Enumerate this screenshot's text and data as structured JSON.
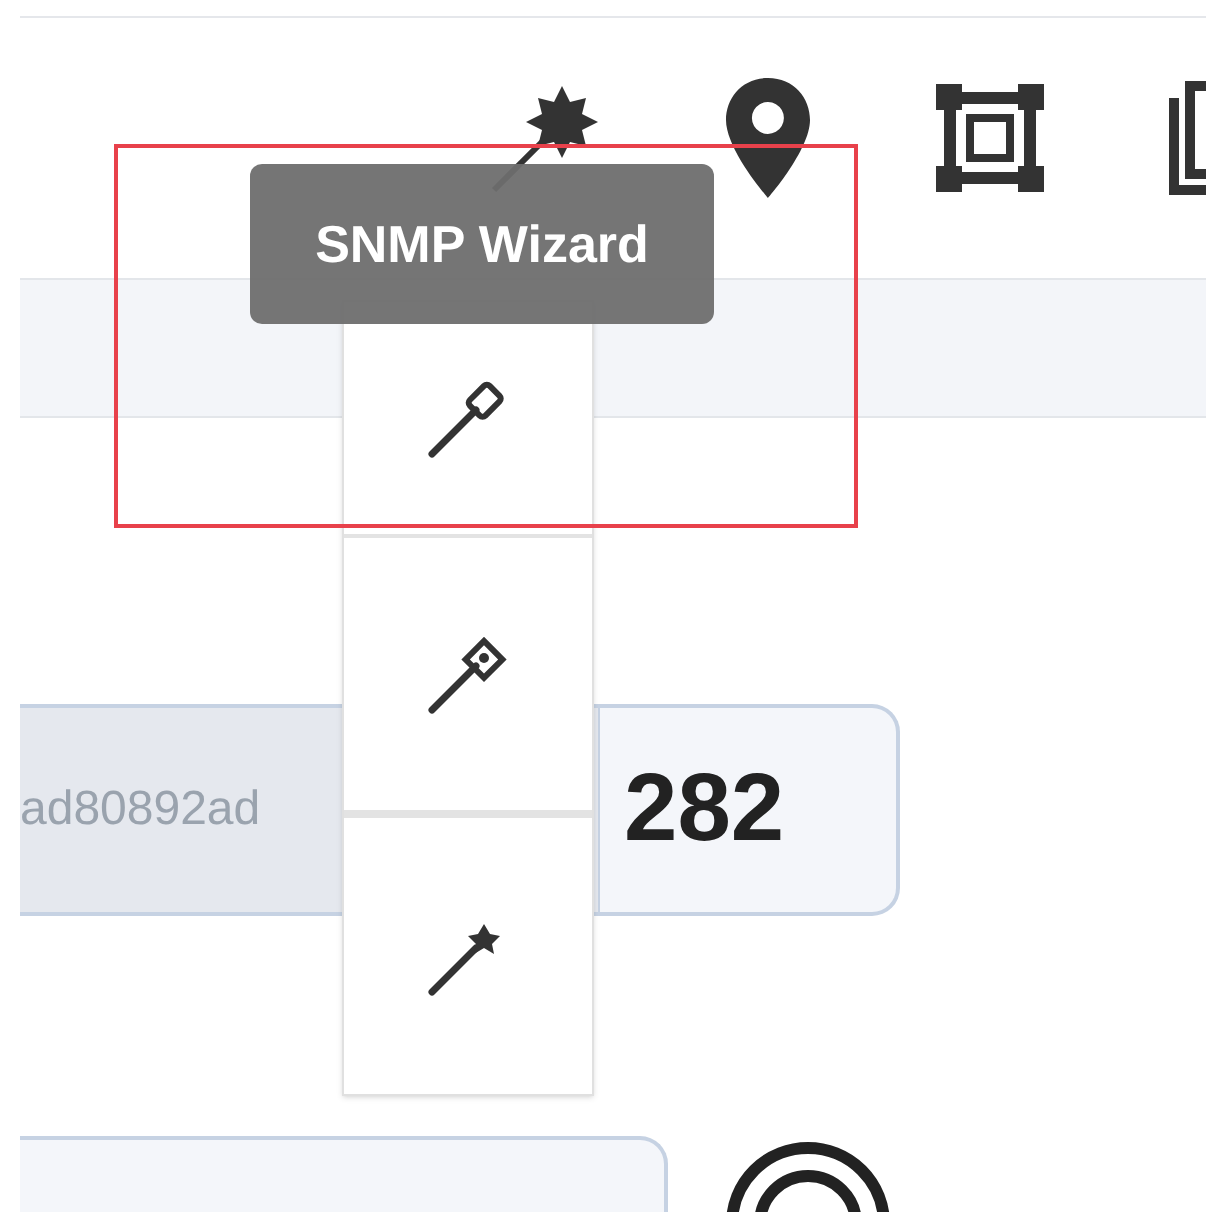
{
  "tooltip": {
    "text": "SNMP Wizard"
  },
  "id_field": {
    "value": "ad80892ad"
  },
  "count_field": {
    "value": "282"
  }
}
